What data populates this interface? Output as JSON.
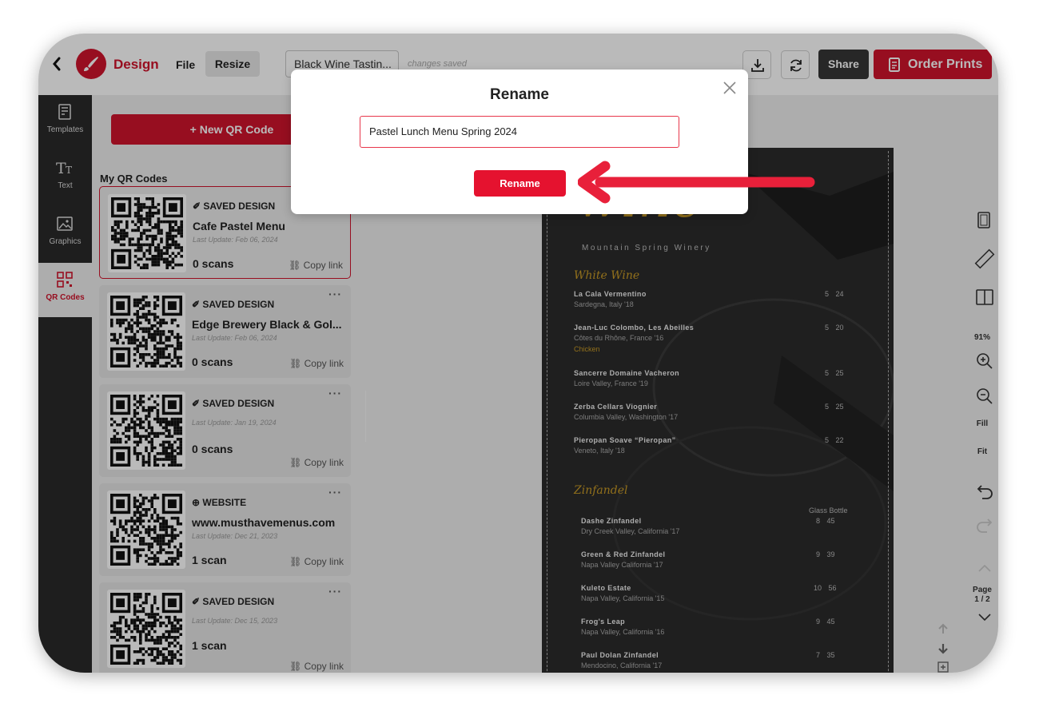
{
  "topbar": {
    "app_title": "Design",
    "menu_file": "File",
    "menu_resize": "Resize",
    "document_title": "Black Wine Tastin...",
    "save_status": "changes saved",
    "share_label": "Share",
    "order_label": "Order Prints",
    "icons": [
      "back-chevron-icon",
      "brush-logo-icon",
      "download-icon",
      "sync-icon",
      "printer-icon"
    ]
  },
  "leftnav": {
    "items": [
      {
        "label": "Templates",
        "icon": "templates-icon"
      },
      {
        "label": "Text",
        "icon": "text-icon"
      },
      {
        "label": "Graphics",
        "icon": "graphics-icon"
      },
      {
        "label": "QR Codes",
        "icon": "qr-code-icon",
        "active": true
      }
    ]
  },
  "panel": {
    "new_button": "+ New QR Code",
    "section_label": "My QR Codes",
    "copy_label": "Copy link",
    "cards": [
      {
        "type": "SAVED DESIGN",
        "type_icon": "pencil-icon",
        "name": "Cafe Pastel Menu",
        "date": "Last Update: Feb 06, 2024",
        "scans": "0 scans",
        "selected": true
      },
      {
        "type": "SAVED DESIGN",
        "type_icon": "pencil-icon",
        "name": "Edge Brewery Black & Gol...",
        "date": "Last Update: Feb 06, 2024",
        "scans": "0 scans"
      },
      {
        "type": "SAVED DESIGN",
        "type_icon": "pencil-icon",
        "name": "",
        "date": "Last Update: Jan 19, 2024",
        "scans": "0 scans"
      },
      {
        "type": "WEBSITE",
        "type_icon": "globe-icon",
        "name": "www.musthavemenus.com",
        "date": "Last Update: Dec 21, 2023",
        "scans": "1 scan"
      },
      {
        "type": "SAVED DESIGN",
        "type_icon": "pencil-icon",
        "name": "",
        "date": "Last Update: Dec 15, 2023",
        "scans": "1 scan"
      }
    ]
  },
  "menu_page": {
    "script_title": "wine",
    "winery": "Mountain Spring Winery",
    "sections": [
      {
        "title": "White Wine",
        "items": [
          {
            "name": "La Cala Vermentino",
            "origin": "Sardegna, Italy '18",
            "price": "5 24"
          },
          {
            "name": "Jean-Luc Colombo, Les Abeilles",
            "origin": "Côtes du Rhône, France '16",
            "note": "Chicken",
            "price": "5 20"
          },
          {
            "name": "Sancerre Domaine Vacheron",
            "origin": "Loire Valley, France '19",
            "price": "5 25"
          },
          {
            "name": "Zerba Cellars Viognier",
            "origin": "Columbia Valley, Washington '17",
            "price": "5 25"
          },
          {
            "name": "Pieropan Soave “Pieropan”",
            "origin": "Veneto, Italy '18",
            "price": "5 22"
          }
        ]
      },
      {
        "title": "Zinfandel",
        "col_headers": "Glass Bottle",
        "items": [
          {
            "name": "Dashe Zinfandel",
            "origin": "Dry Creek Valley, California '17",
            "price": "8 45"
          },
          {
            "name": "Green & Red Zinfandel",
            "origin": "Napa Valley California '17",
            "price": "9 39"
          },
          {
            "name": "Kuleto Estate",
            "origin": "Napa Valley, California '15",
            "price": "10 56"
          },
          {
            "name": "Frog's Leap",
            "origin": "Napa Valley, California '16",
            "price": "9 45"
          },
          {
            "name": "Paul Dolan Zinfandel",
            "origin": "Mendocino, California '17",
            "price": "7 35"
          }
        ]
      }
    ]
  },
  "rail": {
    "zoom": "91%",
    "fill": "Fill",
    "fit": "Fit",
    "page_label": "Page",
    "page_number": "1 / 2",
    "icons": [
      "page-size-icon",
      "ruler-icon",
      "columns-icon",
      "zoom-in-icon",
      "zoom-out-icon",
      "undo-icon",
      "redo-icon",
      "chevron-up-icon",
      "chevron-down-icon"
    ]
  },
  "modal": {
    "title": "Rename",
    "input_value": "Pastel Lunch Menu Spring 2024",
    "button_label": "Rename"
  },
  "colors": {
    "brand_red": "#d0142c",
    "modal_button": "#e5122f",
    "menu_background": "#2b2b2b",
    "menu_gold": "#c89a26",
    "arrow": "#e8203a"
  }
}
